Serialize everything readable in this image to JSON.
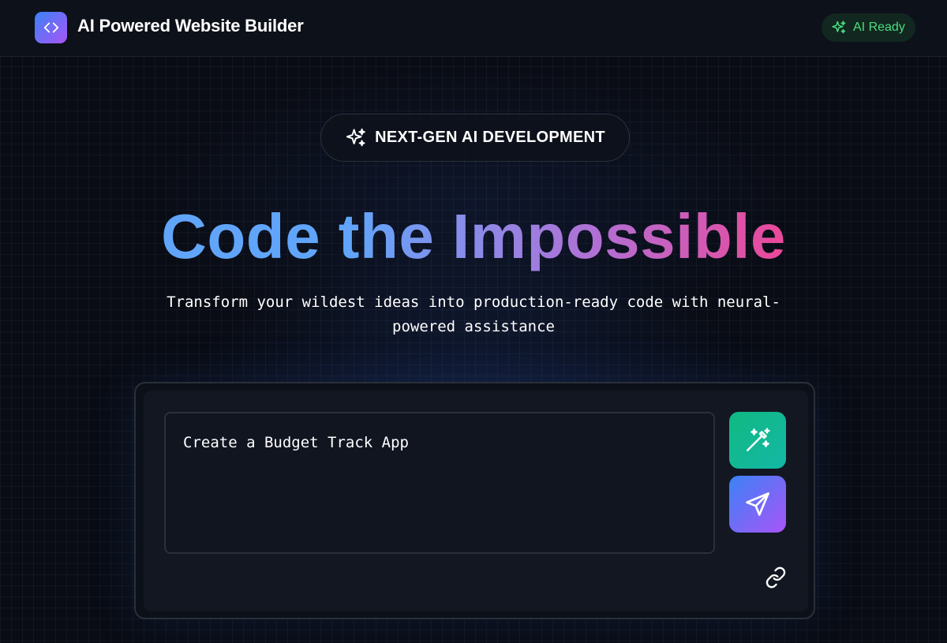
{
  "header": {
    "app_title": "AI Powered Website Builder",
    "logo_icon": "code-brackets-icon",
    "status": {
      "label": "AI Ready",
      "icon": "sparkles-icon",
      "color": "#4ade80"
    }
  },
  "badge": {
    "label": "NEXT-GEN AI DEVELOPMENT",
    "icon": "sparkles-icon"
  },
  "hero": {
    "title": "Code the Impossible",
    "subtitle": "Transform your wildest ideas into production-ready code with neural-powered assistance"
  },
  "prompt": {
    "value": "Create a Budget Track App",
    "enhance_icon": "magic-wand-icon",
    "send_icon": "send-icon",
    "attach_icon": "link-icon"
  },
  "colors": {
    "accent_blue": "#3b82f6",
    "accent_purple": "#a855f7",
    "accent_pink": "#ec4899",
    "accent_green": "#10b981",
    "background": "#090c14"
  }
}
